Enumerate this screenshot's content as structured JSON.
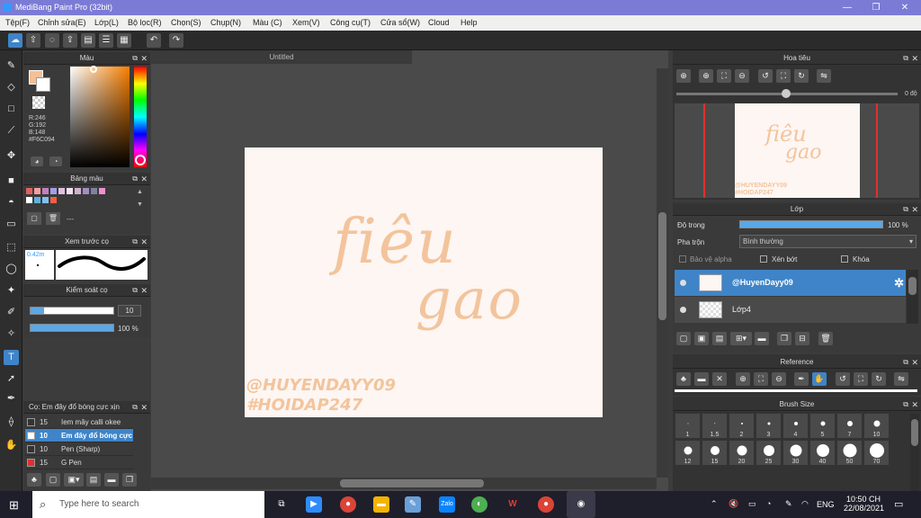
{
  "app": {
    "title": "MediBang Paint Pro (32bit)",
    "min": "—",
    "max": "❐",
    "close": "✕"
  },
  "menu": [
    "Tệp(F)",
    "Chỉnh sửa(E)",
    "Lớp(L)",
    "Bộ lọc(R)",
    "Chọn(S)",
    "Chụp(N)",
    "Màu (C)",
    "Xem(V)",
    "Công cụ(T)",
    "Cửa sổ(W)",
    "Cloud",
    "Help"
  ],
  "document": {
    "tab": "Untitled",
    "text_line1": "fiêu",
    "text_line2": "gao",
    "signature1": "@HUYENDAYY09",
    "signature2": "#HOIDAP247"
  },
  "color_panel": {
    "title": "Màu",
    "r": "R:246",
    "g": "G:192",
    "b": "B:148",
    "hex": "#F6C094",
    "fg": "#f6c094",
    "bg": "#ffffff"
  },
  "palette_panel": {
    "title": "Bảng màu",
    "count": "---",
    "colors": [
      "#e06060",
      "#f0a0a0",
      "#c080c0",
      "#a0a0e0",
      "#e0c0e0",
      "#f0e0f0",
      "#d0b0d0",
      "#a090c0",
      "#8080a0",
      "#f090d0",
      "#ffffff",
      "#60b0e0",
      "#80c0f0",
      "#f06040"
    ]
  },
  "brush_preview": {
    "title": "Xem trước cọ",
    "size": "0.42m"
  },
  "brush_control": {
    "title": "Kiểm soát cọ",
    "size_value": "10",
    "opacity_value": "100 %",
    "size_fraction": 0.1,
    "opacity_fraction": 1.0
  },
  "brush_list": {
    "title": "Cọ: Em đây đổ bóng cực xịn",
    "items": [
      {
        "size": "15",
        "name": "Iem mây calli okee",
        "color": "#333333"
      },
      {
        "size": "10",
        "name": "Em đây đổ bóng cực xịn",
        "color": "#ffffff"
      },
      {
        "size": "10",
        "name": "Pen (Sharp)",
        "color": "#333333"
      },
      {
        "size": "15",
        "name": "G Pen",
        "color": "#e03030"
      }
    ]
  },
  "navigator": {
    "title": "Hoa tiêu",
    "angle": "0 độ"
  },
  "layer_panel": {
    "title": "Lớp",
    "opacity_label": "Độ trong",
    "opacity_value": "100 %",
    "opacity_fraction": 1.0,
    "blend_label": "Pha trộn",
    "blend_value": "Bình thường",
    "protect_alpha": "Bảo vệ alpha",
    "clipping": "Xén bớt",
    "lock": "Khóa",
    "layers": [
      {
        "name": "@HuyenDayy09"
      },
      {
        "name": "Lớp4"
      }
    ]
  },
  "reference": {
    "title": "Reference"
  },
  "brush_size": {
    "title": "Brush Size",
    "sizes": [
      "1",
      "1.5",
      "2",
      "3",
      "4",
      "5",
      "7",
      "10",
      "12",
      "15",
      "20",
      "25",
      "30",
      "40",
      "50",
      "70"
    ]
  },
  "taskbar": {
    "search_placeholder": "Type here to search",
    "lang": "ENG",
    "time": "10:50 CH",
    "date": "22/08/2021"
  }
}
